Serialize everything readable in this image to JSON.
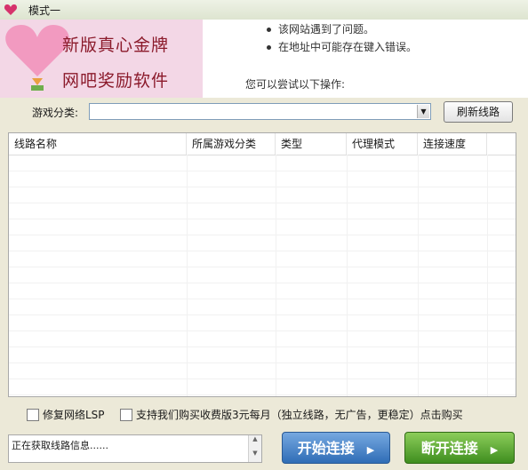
{
  "window": {
    "title": "模式一"
  },
  "banner": {
    "line1": "新版真心金牌",
    "line2": "网吧奖励软件"
  },
  "error_page": {
    "bullets": [
      "该网站遇到了问题。",
      "在地址中可能存在键入错误。"
    ],
    "tip": "您可以尝试以下操作:"
  },
  "toolbar": {
    "category_label": "游戏分类:",
    "category_value": "",
    "refresh_label": "刷新线路"
  },
  "table": {
    "columns": [
      "线路名称",
      "所属游戏分类",
      "类型",
      "代理模式",
      "连接速度"
    ],
    "rows": []
  },
  "options": {
    "repair_lsp": "修复网络LSP",
    "buy_paid": "支持我们购买收费版3元每月（独立线路，无广告，更稳定）点击购买"
  },
  "status": {
    "text": "正在获取线路信息......"
  },
  "buttons": {
    "start": "开始连接",
    "stop": "断开连接"
  },
  "colors": {
    "start_button": "#3a78c2",
    "stop_button": "#4c9a2a",
    "banner_bg": "#f3d7e6",
    "banner_text": "#8b1a2b"
  }
}
